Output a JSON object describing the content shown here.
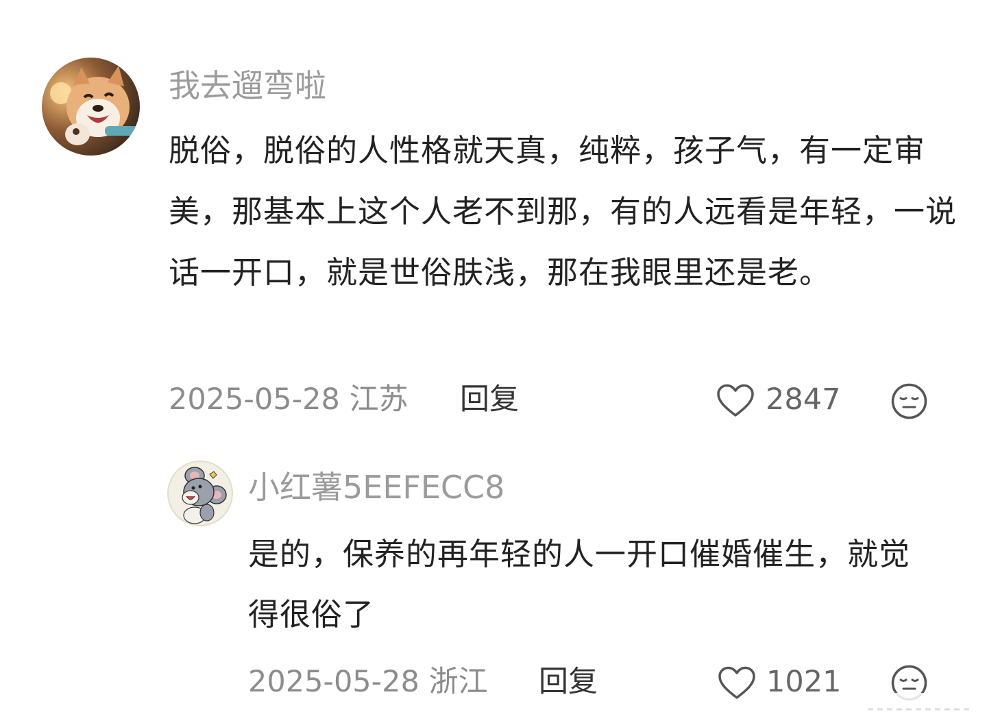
{
  "comments": [
    {
      "username": "我去遛弯啦",
      "avatar": "shiba-dog-avatar",
      "content": "脱俗，脱俗的人性格就天真，纯粹，孩子气，有一定审美，那基本上这个人老不到那，有的人远看是年轻，一说话一开口，就是世俗肤浅，那在我眼里还是老。",
      "date": "2025-05-28",
      "location": "江苏",
      "reply_label": "回复",
      "like_count": "2847",
      "like_icon": "heart-outline-icon",
      "reaction_icon": "neutral-face-icon"
    },
    {
      "username": "小红薯5EEFECC8",
      "avatar": "cartoon-mouse-avatar",
      "content": "是的，保养的再年轻的人一开口催婚催生，就觉得很俗了",
      "date": "2025-05-28",
      "location": "浙江",
      "reply_label": "回复",
      "like_count": "1021",
      "like_icon": "heart-outline-icon",
      "reaction_icon": "neutral-face-icon"
    }
  ],
  "colors": {
    "username": "#9b9b9b",
    "content": "#222222",
    "meta": "#8c8c8c",
    "icon_stroke": "#555555"
  }
}
